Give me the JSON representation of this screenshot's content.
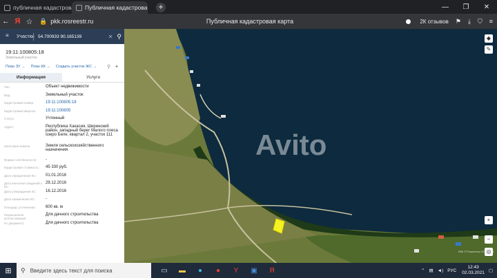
{
  "browser": {
    "tabs": [
      {
        "title": "публичная кадастровая к"
      },
      {
        "title": "Публичная кадастровая"
      }
    ],
    "new_tab": "+",
    "url": "pkk.rosreestr.ru",
    "page_title": "Публичная кадастровая карта",
    "reviews": "2К отзывов"
  },
  "search": {
    "type": "Участки",
    "value": "54.700933 90.165139"
  },
  "parcel": {
    "number": "19:11:100805:18",
    "kind": "Земельный участок",
    "links": [
      "План ЗУ →",
      "План КК →",
      "Создать участок ЖС →"
    ],
    "tabs": [
      "Информация",
      "Услуги"
    ],
    "fields": [
      {
        "key": "Тип:",
        "value": "Объект недвижимости"
      },
      {
        "key": "Вид:",
        "value": "Земельный участок"
      },
      {
        "key": "Кадастровый номер:",
        "value": "19:11:100805:18",
        "link": true
      },
      {
        "key": "Кадастровый квартал:",
        "value": "19:11:100805",
        "link": true
      },
      {
        "key": "Статус:",
        "value": "Учтенный"
      },
      {
        "key": "Адрес:",
        "value": "Республика Хакасия, Ширинский район, западный берег Малого плеса озеро Беле, квартал 2, участок 111"
      },
      {
        "key": "Категория земель:",
        "value": "Земли сельскохозяйственного назначения"
      },
      {
        "key": "Форма собственности:",
        "value": "-"
      },
      {
        "key": "Кадастровая стоимость:",
        "value": "45 330 руб."
      },
      {
        "key": "Дата определения КС:",
        "value": "01.01.2016"
      },
      {
        "key": "Дата внесения сведений о КС:",
        "value": "29.12.2016"
      },
      {
        "key": "Дата утверждения КС:",
        "value": "16.12.2016"
      },
      {
        "key": "Дата применения КС:",
        "value": "-"
      },
      {
        "key": "Площадь уточненная:",
        "value": "600 кв. м"
      },
      {
        "key": "Разрешенное использование:",
        "value": "Для дачного строительства"
      },
      {
        "key": "по документу:",
        "value": "Для дачного строительства"
      }
    ]
  },
  "map": {
    "watermark": "Avito",
    "attribution": "ПКК © Росреестр 2010-2021"
  },
  "taskbar": {
    "search_placeholder": "Введите здесь текст для поиска",
    "lang": "РУС",
    "time": "12:43",
    "date": "02.03.2021"
  }
}
